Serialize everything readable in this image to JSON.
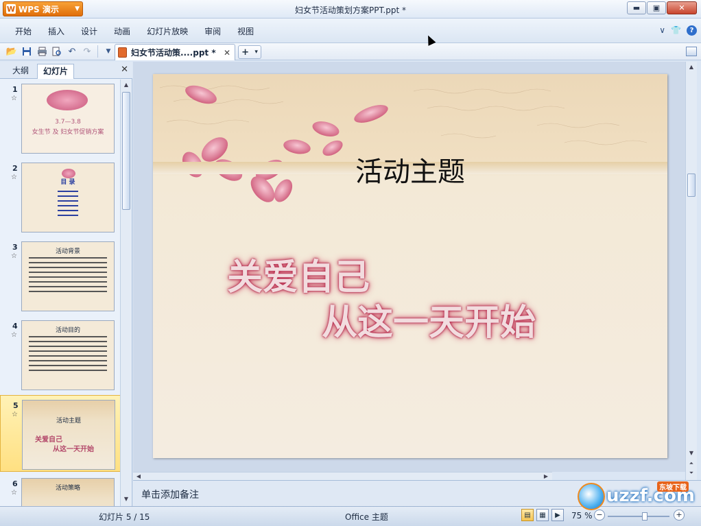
{
  "app": {
    "menu_label": "WPS 演示",
    "logo_letter": "W",
    "window_title": "妇女节活动策划方案PPT.ppt *"
  },
  "window_controls": {
    "minimize": "▬",
    "maximize": "▣",
    "close": "✕"
  },
  "menu": {
    "items": [
      "开始",
      "插入",
      "设计",
      "动画",
      "幻灯片放映",
      "审阅",
      "视图"
    ],
    "right_chevron": "∨",
    "help": "?"
  },
  "toolbar": {
    "doc_tab_label": "妇女节活动策....ppt *",
    "doc_tab_close": "✕",
    "new_tab": "+",
    "new_tab_arrow": "▾"
  },
  "left_panel": {
    "tab_outline": "大纲",
    "tab_slides": "幻灯片",
    "close": "✕",
    "selected_index": 5,
    "thumbnails": [
      {
        "num": "1",
        "lines": [
          "3.7—3.8",
          "女生节 及 妇女节促销方案"
        ]
      },
      {
        "num": "2",
        "lines": [
          "目 录"
        ]
      },
      {
        "num": "3",
        "lines": [
          "活动背景"
        ]
      },
      {
        "num": "4",
        "lines": [
          "活动目的"
        ]
      },
      {
        "num": "5",
        "lines": [
          "活动主题",
          "关爱自己",
          "从这一天开始"
        ]
      },
      {
        "num": "6",
        "lines": [
          "活动策略"
        ]
      }
    ]
  },
  "slide": {
    "title": "活动主题",
    "line1": "关爱自己",
    "line2": "从这一天开始"
  },
  "notes_placeholder": "单击添加备注",
  "status": {
    "slide_info": "幻灯片 5 / 15",
    "theme": "Office 主题",
    "zoom": "75 %"
  },
  "watermark": {
    "text": "uzzf.com",
    "tag": "东坡下载"
  }
}
